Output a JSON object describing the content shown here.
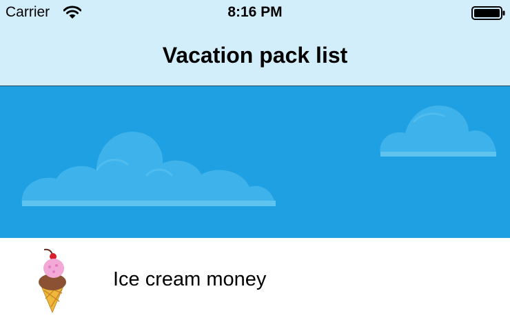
{
  "status_bar": {
    "carrier": "Carrier",
    "time": "8:16 PM",
    "wifi_icon": "wifi-icon",
    "battery_icon": "battery-icon"
  },
  "nav_bar": {
    "title": "Vacation pack list"
  },
  "header_illustration": {
    "sky_color": "#1ea0e2",
    "cloud_color": "#3eb2ea"
  },
  "list": {
    "items": [
      {
        "label": "Ice cream money",
        "icon": "ice-cream-icon"
      }
    ]
  }
}
